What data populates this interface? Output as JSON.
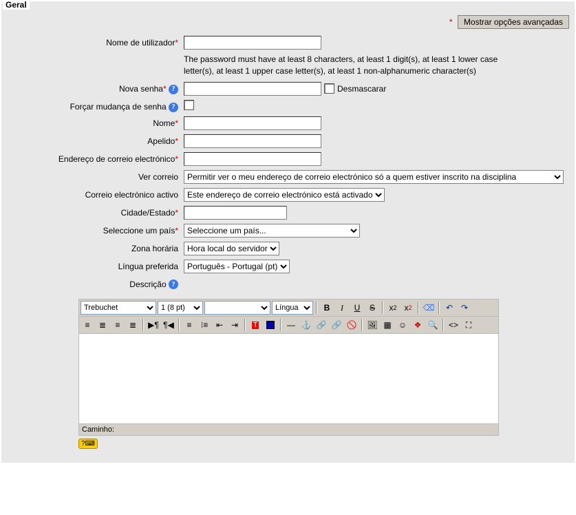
{
  "legend": "Geral",
  "advanced": {
    "marker": "*",
    "label": "Mostrar opções avançadas"
  },
  "fields": {
    "username": {
      "label": "Nome de utilizador",
      "value": ""
    },
    "password_hint": "The password must have at least 8 characters, at least 1 digit(s), at least 1 lower case letter(s), at least 1 upper case letter(s), at least 1 non-alphanumeric character(s)",
    "new_password": {
      "label": "Nova senha",
      "value": "",
      "unmask": "Desmascarar"
    },
    "force_change": {
      "label": "Forçar mudança de senha"
    },
    "firstname": {
      "label": "Nome",
      "value": ""
    },
    "lastname": {
      "label": "Apelido",
      "value": ""
    },
    "email": {
      "label": "Endereço de correio electrónico",
      "value": ""
    },
    "email_display": {
      "label": "Ver correio",
      "selected": "Permitir ver o meu endereço de correio electrónico só a quem estiver inscrito na disciplina"
    },
    "email_active": {
      "label": "Correio electrónico activo",
      "selected": "Este endereço de correio electrónico está activado"
    },
    "city": {
      "label": "Cidade/Estado",
      "value": ""
    },
    "country": {
      "label": "Seleccione um país",
      "selected": "Seleccione um país..."
    },
    "timezone": {
      "label": "Zona horária",
      "selected": "Hora local do servidor"
    },
    "lang": {
      "label": "Língua preferida",
      "selected": "Português - Portugal (pt)"
    },
    "description": {
      "label": "Descrição"
    }
  },
  "editor": {
    "font": "Trebuchet",
    "size": "1 (8 pt)",
    "style": "",
    "lang_label": "Língua",
    "path_label": "Caminho:"
  }
}
